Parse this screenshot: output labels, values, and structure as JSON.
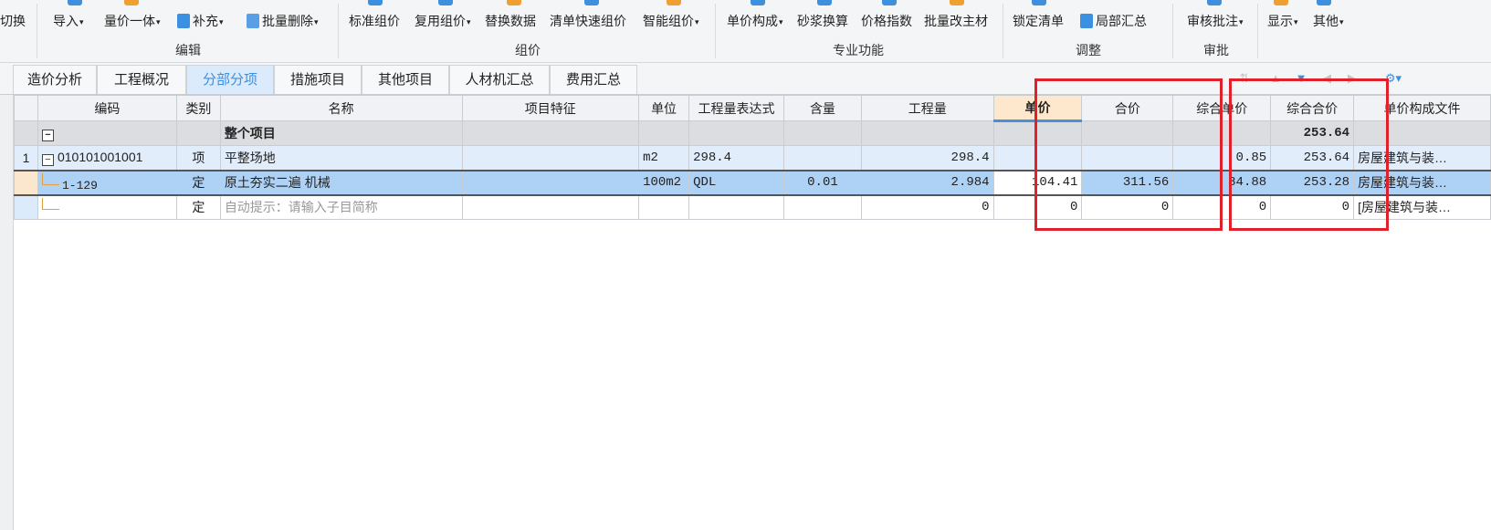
{
  "ribbon": {
    "buttons": {
      "switch": "切换",
      "import": "导入",
      "price_all": "量价一体",
      "supplement": "补充",
      "batch_delete": "批量删除",
      "std_group": "标准组价",
      "reuse_group": "复用组价",
      "replace_data": "替换数据",
      "quick_group": "清单快速组价",
      "smart_group": "智能组价",
      "unit_composition": "单价构成",
      "mortar": "砂浆换算",
      "price_index": "价格指数",
      "batch_material": "批量改主材",
      "lock_list": "锁定清单",
      "partial_sum": "局部汇总",
      "review": "审核批注",
      "display": "显示",
      "other": "其他"
    },
    "groups": {
      "edit": "编辑",
      "group_price": "组价",
      "professional": "专业功能",
      "adjust": "调整",
      "approve": "审批"
    }
  },
  "tabs": [
    "造价分析",
    "工程概况",
    "分部分项",
    "措施项目",
    "其他项目",
    "人材机汇总",
    "费用汇总"
  ],
  "active_tab": "分部分项",
  "table": {
    "columns": [
      "编码",
      "类别",
      "名称",
      "项目特征",
      "单位",
      "工程量表达式",
      "含量",
      "工程量",
      "单价",
      "合价",
      "综合单价",
      "综合合价",
      "单价构成文件"
    ],
    "total_row": {
      "toggle": "−",
      "name": "整个项目",
      "total_price": "253.64"
    },
    "item_row": {
      "index": "1",
      "toggle": "−",
      "code": "010101001001",
      "type": "项",
      "name": "平整场地",
      "unit": "m2",
      "expr": "298.4",
      "qty": "298.4",
      "comp_unit_price": "0.85",
      "comp_total": "253.64",
      "file": "房屋建筑与装…"
    },
    "sub_row": {
      "code": "1-129",
      "type": "定",
      "name": "原土夯实二遍 机械",
      "unit": "100m2",
      "expr": "QDL",
      "content": "0.01",
      "qty": "2.984",
      "unit_price": "104.41",
      "total": "311.56",
      "comp_unit_price": "84.88",
      "comp_total": "253.28",
      "file": "房屋建筑与装…"
    },
    "hint_row": {
      "type": "定",
      "name": "自动提示：请输入子目简称",
      "qty": "0",
      "unit_price": "0",
      "total": "0",
      "comp_unit_price": "0",
      "comp_total": "0",
      "file": "[房屋建筑与装…"
    }
  },
  "colors": {
    "accent": "#3d8fe0",
    "highlight_box": "#e0202a",
    "selected_row": "#aed1f6"
  }
}
